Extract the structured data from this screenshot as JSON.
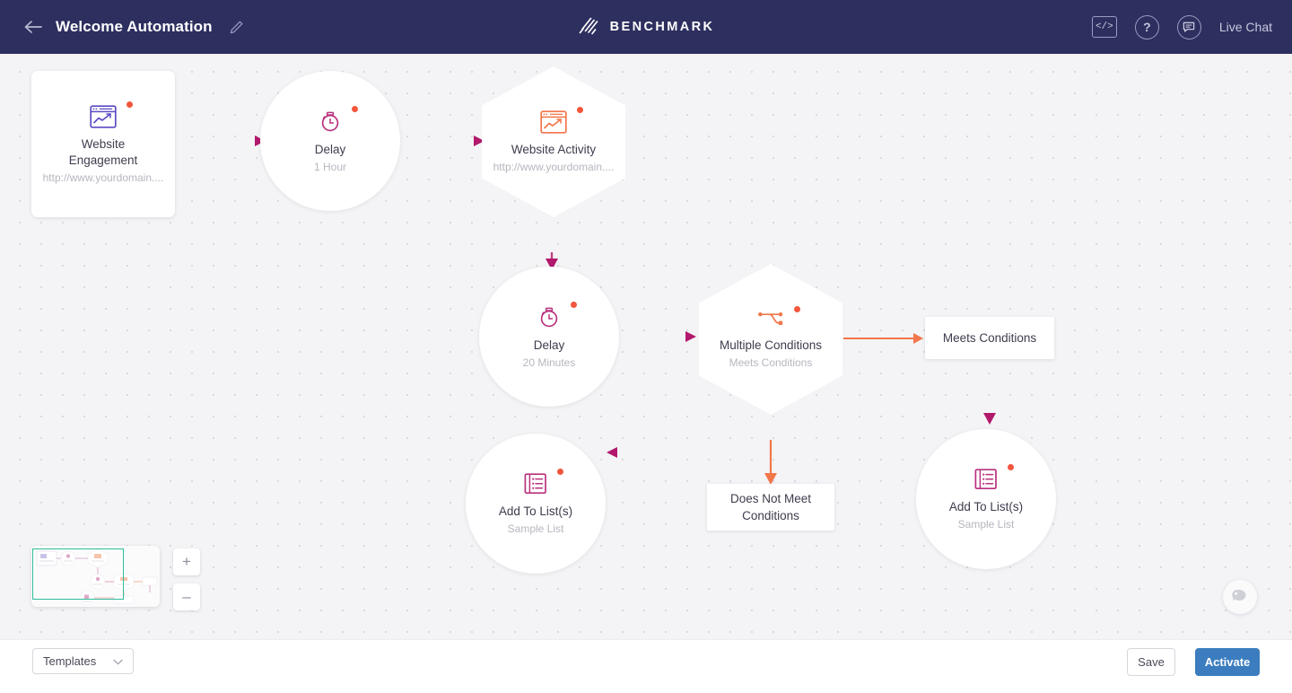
{
  "header": {
    "back_icon": "back-arrow-icon",
    "title": "Welcome Automation",
    "edit_icon": "pencil-icon",
    "brand_name": "BENCHMARK",
    "brand_logo_icon": "benchmark-slashes-logo",
    "code_icon": "code-embed-icon",
    "code_glyph": "</>",
    "help_icon": "question-mark-icon",
    "help_glyph": "?",
    "chat_icon": "chat-bubble-icon",
    "live_chat_label": "Live Chat",
    "bg_color": "#2d2f5f"
  },
  "canvas": {
    "bg_color": "#f4f4f6",
    "dot_color": "#d9d9de",
    "fab_icon": "support-chat-icon",
    "minimap": {
      "name": "minimap",
      "viewport_color": "#2fbd9a"
    },
    "zoom_in_label": "+",
    "zoom_out_label": "–"
  },
  "nodes": [
    {
      "id": "website-engagement",
      "shape": "square",
      "icon": "browser-chart-icon",
      "icon_color": "#5b4bc4",
      "title": "Website Engagement",
      "subtitle": "http://www.yourdomain....",
      "badge_color": "#f2563d"
    },
    {
      "id": "delay-1-hour",
      "shape": "circle",
      "icon": "stopwatch-icon",
      "icon_color": "#b9327e",
      "title": "Delay",
      "subtitle": "1 Hour",
      "badge_color": "#f2563d"
    },
    {
      "id": "website-activity",
      "shape": "hexagon",
      "icon": "browser-chart-icon",
      "icon_color": "#f2764b",
      "title": "Website Activity",
      "subtitle": "http://www.yourdomain....",
      "badge_color": "#f2563d"
    },
    {
      "id": "delay-20-minutes",
      "shape": "circle",
      "icon": "stopwatch-icon",
      "icon_color": "#b9327e",
      "title": "Delay",
      "subtitle": "20 Minutes",
      "badge_color": "#f2563d"
    },
    {
      "id": "multiple-conditions",
      "shape": "hexagon",
      "icon": "branch-split-icon",
      "icon_color": "#f2764b",
      "title": "Multiple Conditions",
      "subtitle": "Meets Conditions",
      "badge_color": "#f2563d"
    },
    {
      "id": "add-to-lists-left",
      "shape": "circle",
      "icon": "list-notebook-icon",
      "icon_color": "#b9327e",
      "title": "Add To List(s)",
      "subtitle": "Sample List",
      "badge_color": "#f2563d"
    },
    {
      "id": "add-to-lists-right",
      "shape": "circle",
      "icon": "list-notebook-icon",
      "icon_color": "#b9327e",
      "title": "Add To List(s)",
      "subtitle": "Sample List",
      "badge_color": "#f2563d"
    }
  ],
  "condition_boxes": [
    {
      "id": "meets-conditions",
      "label": "Meets Conditions"
    },
    {
      "id": "does-not-meet-conditions",
      "label": "Does Not Meet Conditions"
    }
  ],
  "edge_colors": {
    "purple_start": "#6b4ec9",
    "magenta": "#b2186b",
    "orange": "#f2764b",
    "salmon": "#ef6a5a"
  },
  "footer": {
    "templates_label": "Templates",
    "templates_caret_icon": "chevron-down-icon",
    "save_label": "Save",
    "activate_label": "Activate",
    "activate_color": "#3b7dbf"
  }
}
